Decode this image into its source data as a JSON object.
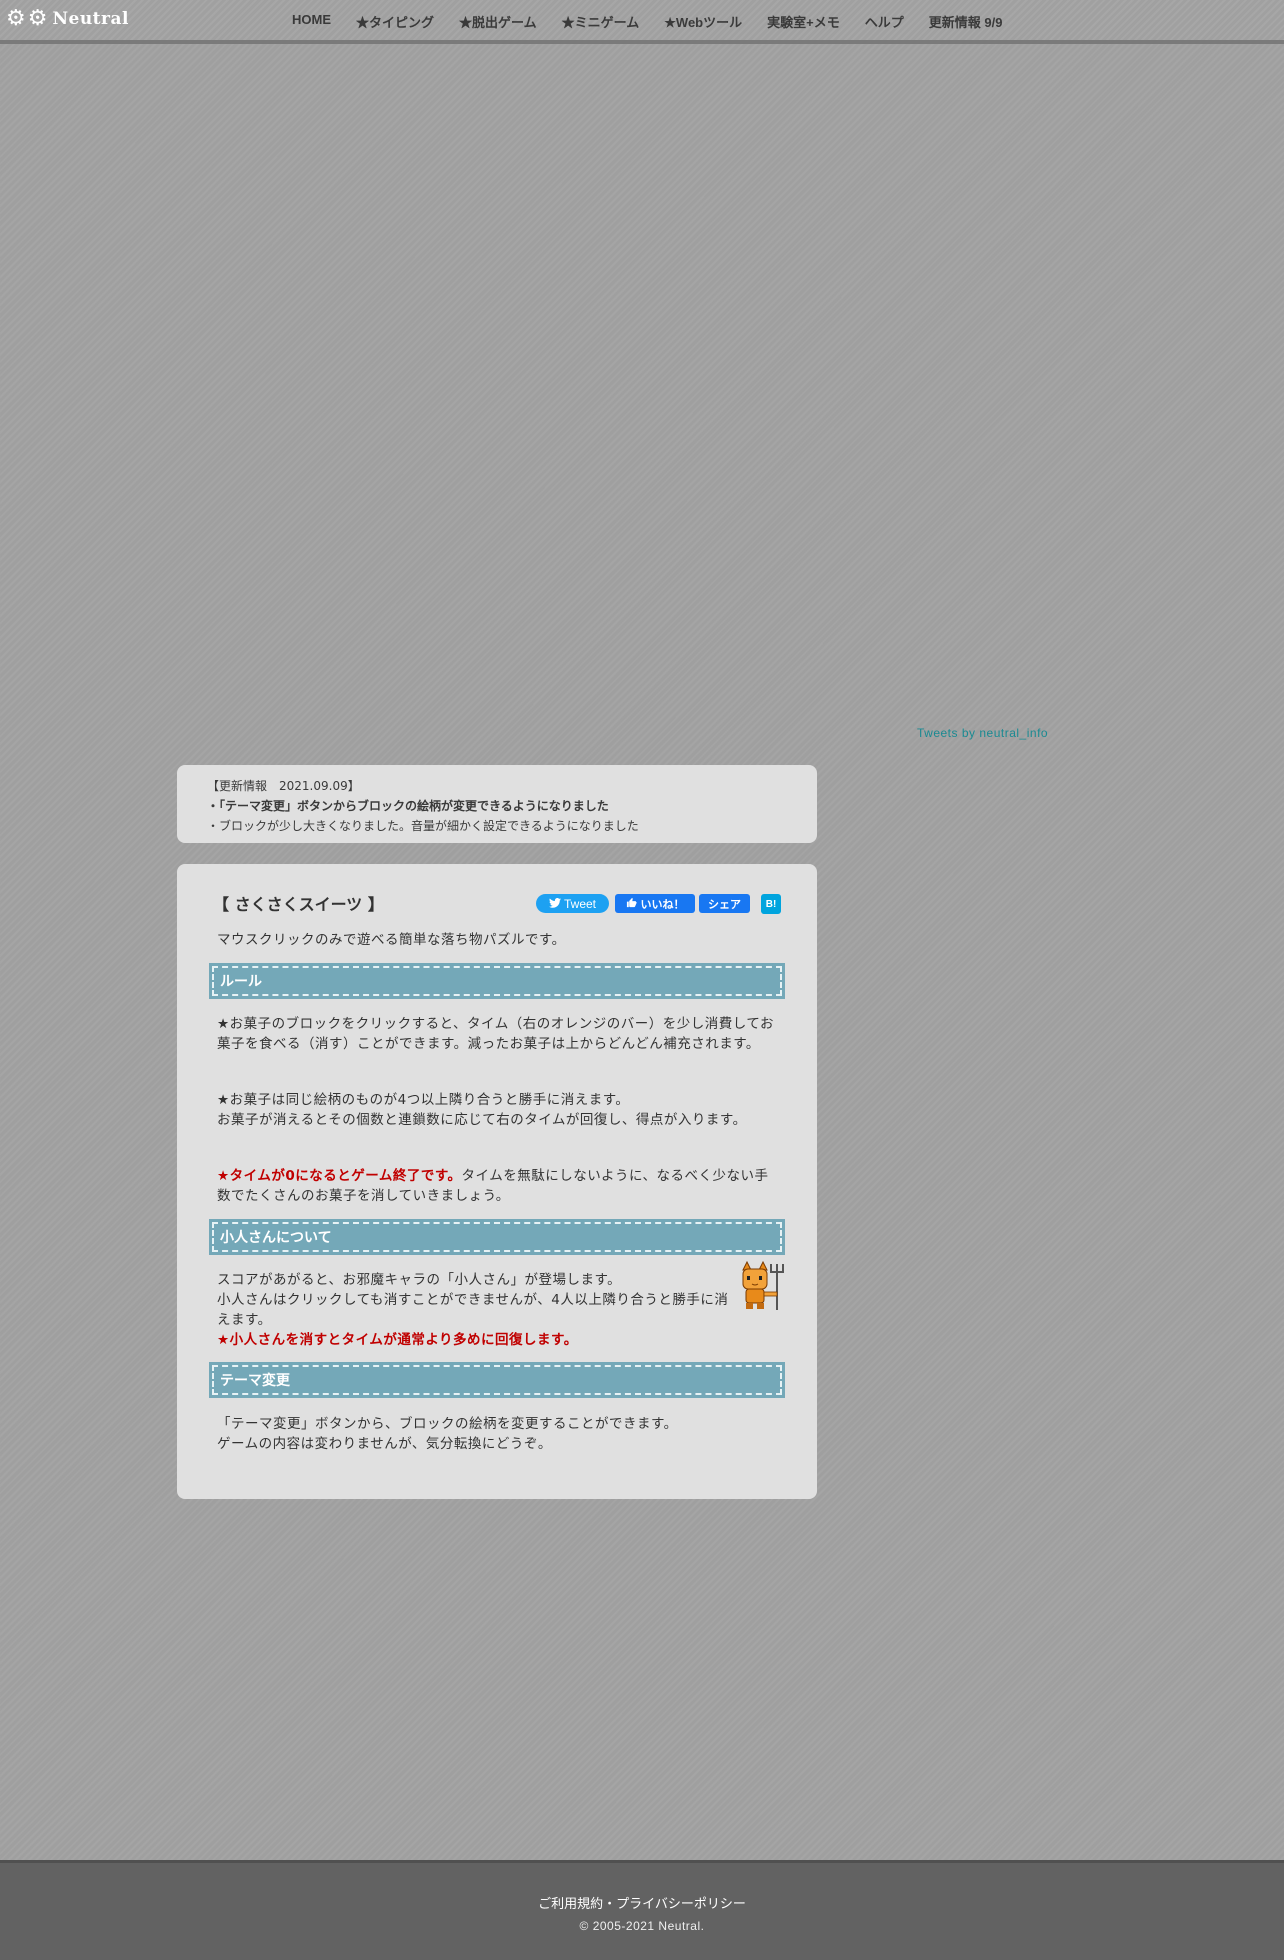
{
  "header": {
    "logo_text": "Neutral",
    "nav": [
      "HOME",
      "★タイピング",
      "★脱出ゲーム",
      "★ミニゲーム",
      "★Webツール",
      "実験室+メモ",
      "ヘルプ",
      "更新情報 9/9"
    ]
  },
  "twitter_link": "Tweets by neutral_info",
  "news": {
    "heading": "【更新情報　2021.09.09】",
    "items": [
      "・「テーマ変更」ボタンからブロックの絵柄が変更できるようになりました",
      "・ブロックが少し大きくなりました。音量が細かく設定できるようになりました"
    ]
  },
  "game": {
    "title": "【 さくさくスイーツ 】",
    "share": {
      "tweet": "Tweet",
      "like": "いいね！",
      "share": "シェア",
      "hatena": "B!"
    },
    "intro": "マウスクリックのみで遊べる簡単な落ち物パズルです。",
    "sections": {
      "rules": "ルール",
      "kobito": "小人さんについて",
      "theme": "テーマ変更"
    },
    "rules": {
      "p1": "★お菓子のブロックをクリックすると、タイム（右のオレンジのバー）を少し消費してお菓子を食べる（消す）ことができます。減ったお菓子は上からどんどん補充されます。",
      "p2a": "★お菓子は同じ絵柄のものが4つ以上隣り合うと勝手に消えます。",
      "p2b": "お菓子が消えるとその個数と連鎖数に応じて右のタイムが回復し、得点が入ります。",
      "p3_red": "★タイムが0になるとゲーム終了です。",
      "p3": "タイムを無駄にしないように、なるべく少ない手数でたくさんのお菓子を消していきましょう。"
    },
    "kobito": {
      "p1": "スコアがあがると、お邪魔キャラの「小人さん」が登場します。",
      "p2": "小人さんはクリックしても消すことができませんが、4人以上隣り合うと勝手に消えます。",
      "p3_red": "★小人さんを消すとタイムが通常より多めに回復します。"
    },
    "theme": {
      "p1": "「テーマ変更」ボタンから、ブロックの絵柄を変更することができます。",
      "p2": "ゲームの内容は変わりませんが、気分転換にどうぞ。"
    }
  },
  "footer": {
    "links": "ご利用規約・プライバシーポリシー",
    "copyright": "© 2005-2021 Neutral."
  },
  "colors": {
    "section_header": "#74a8b8",
    "accent_red": "#c00000",
    "twitter_blue": "#1da1f2",
    "facebook_blue": "#1877f2",
    "hatena_blue": "#00a4de",
    "link_teal": "#1a8a92"
  }
}
